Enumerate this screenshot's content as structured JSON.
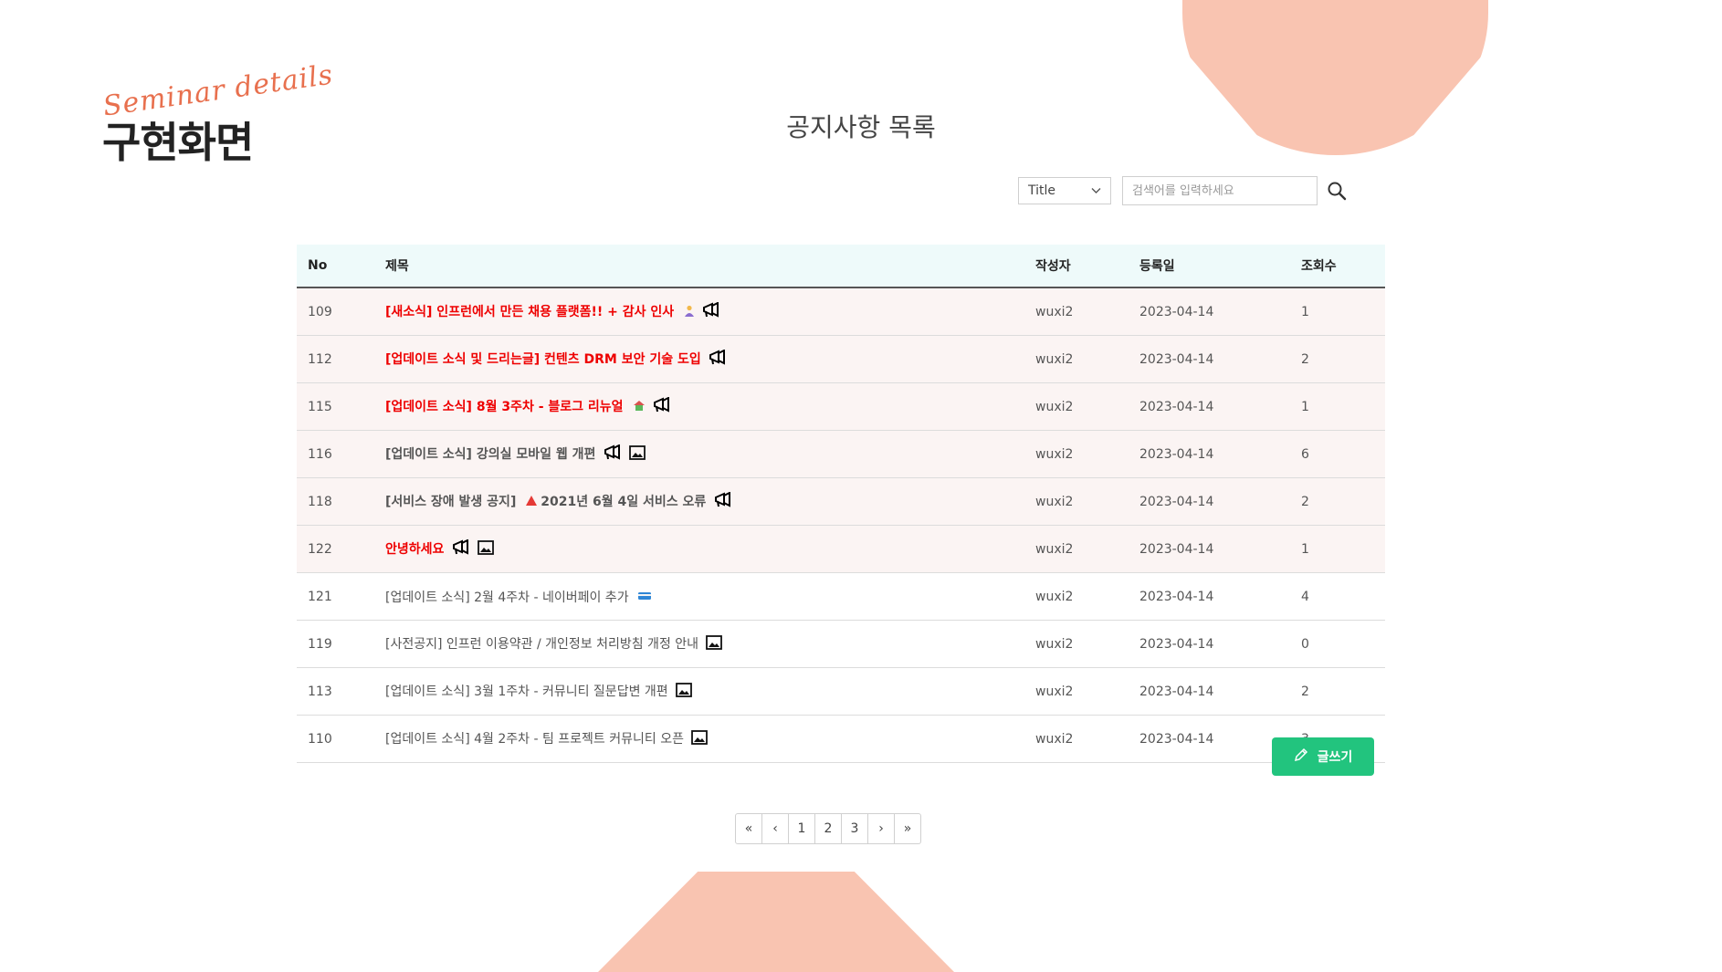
{
  "brand": {
    "script": "Seminar details",
    "title": "구현화면"
  },
  "page": {
    "title": "공지사항 목록"
  },
  "search": {
    "select_value": "Title",
    "placeholder": "검색어를 입력하세요"
  },
  "table": {
    "headers": {
      "no": "No",
      "title": "제목",
      "writer": "작성자",
      "date": "등록일",
      "views": "조회수"
    },
    "rows": [
      {
        "no": "109",
        "title": "[새소식] 인프런에서 만든 채용 플랫폼!! + 감사 인사",
        "writer": "wuxi2",
        "date": "2023-04-14",
        "views": "1"
      },
      {
        "no": "112",
        "title": "[업데이트 소식 및 드리는글] 컨텐츠 DRM 보안 기술 도입",
        "writer": "wuxi2",
        "date": "2023-04-14",
        "views": "2"
      },
      {
        "no": "115",
        "title": "[업데이트 소식] 8월 3주차 - 블로그 리뉴얼",
        "writer": "wuxi2",
        "date": "2023-04-14",
        "views": "1"
      },
      {
        "no": "116",
        "title": "[업데이트 소식] 강의실 모바일 웹 개편",
        "writer": "wuxi2",
        "date": "2023-04-14",
        "views": "6"
      },
      {
        "no": "118",
        "title_a": "[서비스 장애 발생 공지]",
        "title_b": "2021년 6월 4일 서비스 오류",
        "writer": "wuxi2",
        "date": "2023-04-14",
        "views": "2"
      },
      {
        "no": "122",
        "title": "안녕하세요",
        "writer": "wuxi2",
        "date": "2023-04-14",
        "views": "1"
      },
      {
        "no": "121",
        "title": "[업데이트 소식] 2월 4주차 - 네이버페이 추가",
        "writer": "wuxi2",
        "date": "2023-04-14",
        "views": "4"
      },
      {
        "no": "119",
        "title": "[사전공지] 인프런 이용약관 / 개인정보 처리방침 개정 안내",
        "writer": "wuxi2",
        "date": "2023-04-14",
        "views": "0"
      },
      {
        "no": "113",
        "title": "[업데이트 소식] 3월 1주차 - 커뮤니티 질문답변 개편",
        "writer": "wuxi2",
        "date": "2023-04-14",
        "views": "2"
      },
      {
        "no": "110",
        "title": "[업데이트 소식] 4월 2주차 - 팀 프로젝트 커뮤니티 오픈",
        "writer": "wuxi2",
        "date": "2023-04-14",
        "views": "3"
      }
    ]
  },
  "write_button": {
    "label": "글쓰기"
  },
  "pagination": {
    "first": "«",
    "prev": "‹",
    "pages": [
      "1",
      "2",
      "3"
    ],
    "next": "›",
    "last": "»"
  },
  "colors": {
    "accent": "#22c47e",
    "notice_red": "#ee0000",
    "blob": "#f9c4b1",
    "header_bg": "#eefafa"
  }
}
